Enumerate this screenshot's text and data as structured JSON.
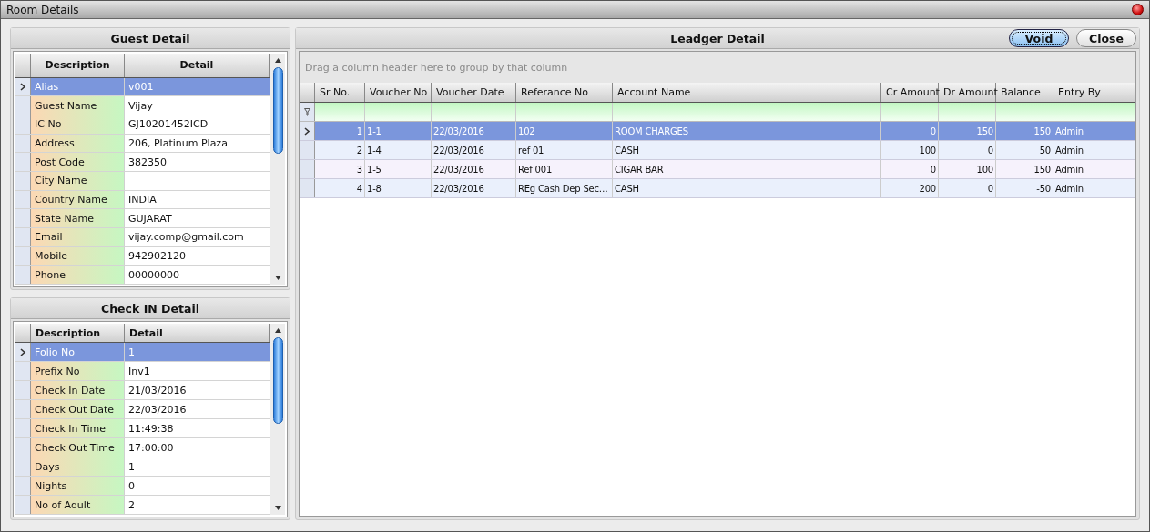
{
  "window": {
    "title": "Room Details"
  },
  "guest_detail": {
    "title": "Guest Detail",
    "columns": [
      "Description",
      "Detail"
    ],
    "rows": [
      {
        "description": "Alias",
        "detail": "v001",
        "selected": true
      },
      {
        "description": "Guest Name",
        "detail": "Vijay",
        "selected": false
      },
      {
        "description": "IC No",
        "detail": "GJ10201452ICD",
        "selected": false
      },
      {
        "description": "Address",
        "detail": "206, Platinum Plaza",
        "selected": false
      },
      {
        "description": "Post Code",
        "detail": "382350",
        "selected": false
      },
      {
        "description": "City Name",
        "detail": "",
        "selected": false
      },
      {
        "description": "Country Name",
        "detail": "INDIA",
        "selected": false
      },
      {
        "description": "State Name",
        "detail": "GUJARAT",
        "selected": false
      },
      {
        "description": "Email",
        "detail": "vijay.comp@gmail.com",
        "selected": false
      },
      {
        "description": "Mobile",
        "detail": "942902120",
        "selected": false
      },
      {
        "description": "Phone",
        "detail": "00000000",
        "selected": false
      }
    ]
  },
  "checkin_detail": {
    "title": "Check IN Detail",
    "columns": [
      "Description",
      "Detail"
    ],
    "rows": [
      {
        "description": "Folio No",
        "detail": "1",
        "selected": true
      },
      {
        "description": "Prefix No",
        "detail": "Inv1",
        "selected": false
      },
      {
        "description": "Check In Date",
        "detail": "21/03/2016",
        "selected": false
      },
      {
        "description": "Check Out Date",
        "detail": "22/03/2016",
        "selected": false
      },
      {
        "description": "Check In Time",
        "detail": "11:49:38",
        "selected": false
      },
      {
        "description": "Check Out Time",
        "detail": "17:00:00",
        "selected": false
      },
      {
        "description": "Days",
        "detail": "1",
        "selected": false
      },
      {
        "description": "Nights",
        "detail": "0",
        "selected": false
      },
      {
        "description": "No of Adult",
        "detail": "2",
        "selected": false
      }
    ]
  },
  "ledger_detail": {
    "title": "Leadger Detail",
    "buttons": [
      {
        "label": "Void",
        "focused": true
      },
      {
        "label": "Close",
        "focused": false
      }
    ],
    "group_hint": "Drag a column header here to group by that column",
    "columns": [
      "Sr No.",
      "Voucher No",
      "Voucher Date",
      "Referance No",
      "Account Name",
      "Cr Amount",
      "Dr Amount",
      "Balance",
      "Entry By"
    ],
    "rows": [
      {
        "cells": [
          "1",
          "1-1",
          "22/03/2016",
          "102",
          "ROOM CHARGES",
          "0",
          "150",
          "150",
          "Admin"
        ],
        "selected": true
      },
      {
        "cells": [
          "2",
          "1-4",
          "22/03/2016",
          "ref 01",
          "CASH",
          "100",
          "0",
          "50",
          "Admin"
        ],
        "selected": false
      },
      {
        "cells": [
          "3",
          "1-5",
          "22/03/2016",
          "Ref 001",
          "CIGAR BAR",
          "0",
          "100",
          "150",
          "Admin"
        ],
        "selected": false
      },
      {
        "cells": [
          "4",
          "1-8",
          "22/03/2016",
          "REg Cash Dep Sec…",
          "CASH",
          "200",
          "0",
          "-50",
          "Admin"
        ],
        "selected": false
      }
    ]
  }
}
